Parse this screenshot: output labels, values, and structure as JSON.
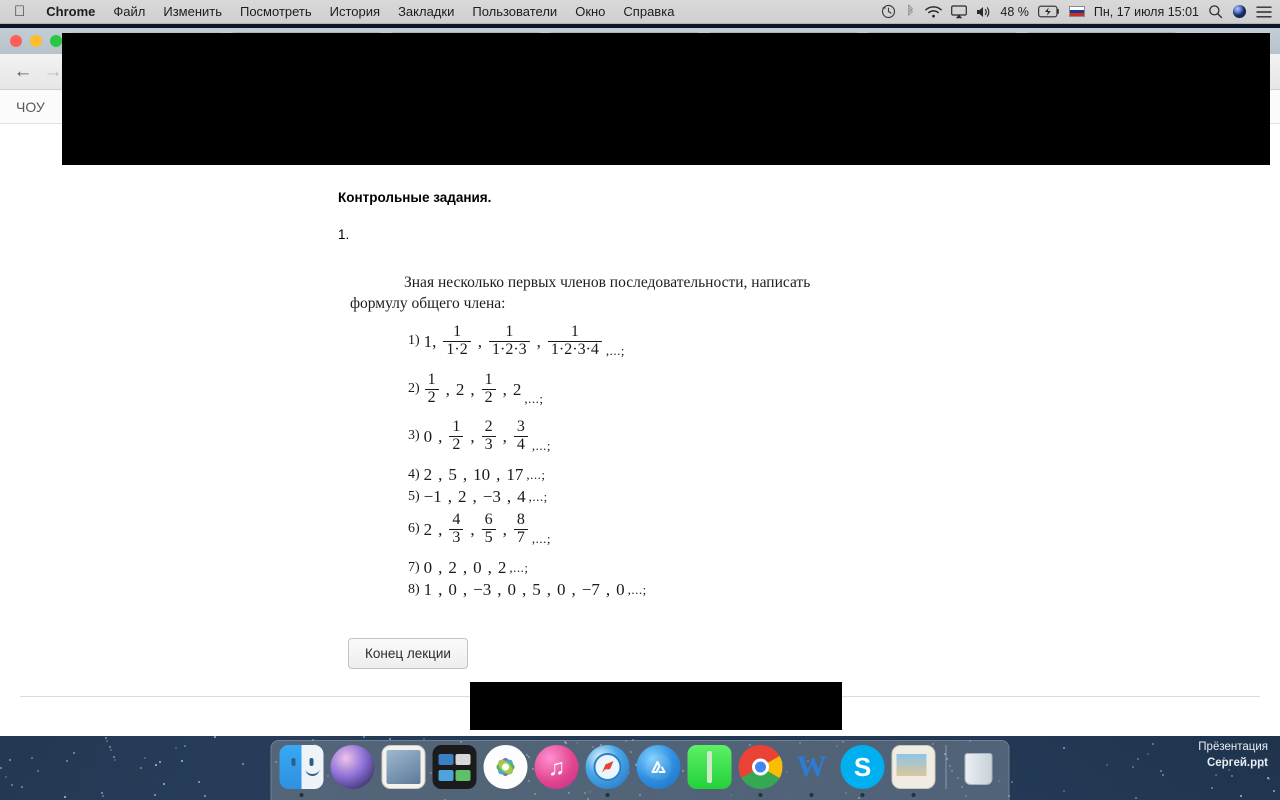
{
  "menubar": {
    "apple_icon": "apple-icon",
    "items": [
      {
        "label": "Chrome",
        "bold": true
      },
      {
        "label": "Файл",
        "bold": false
      },
      {
        "label": "Изменить",
        "bold": false
      },
      {
        "label": "Посмотреть",
        "bold": false
      },
      {
        "label": "История",
        "bold": false
      },
      {
        "label": "Закладки",
        "bold": false
      },
      {
        "label": "Пользователи",
        "bold": false
      },
      {
        "label": "Окно",
        "bold": false
      },
      {
        "label": "Справка",
        "bold": false
      }
    ],
    "status": {
      "time_machine_icon": "time-machine-icon",
      "bluetooth_icon": "bluetooth-icon",
      "wifi_icon": "wifi-icon",
      "airplay_icon": "airplay-icon",
      "volume_icon": "volume-icon",
      "battery_percent": "48 %",
      "battery_icon": "battery-charging-icon",
      "input_flag": "russian-flag-icon",
      "datetime": "Пн, 17 июля  15:01",
      "search_icon": "search-icon",
      "siri_icon": "siri-icon",
      "control_center_icon": "control-center-icon"
    }
  },
  "browser": {
    "traffic_lights": [
      "#ff5f57",
      "#ffbd2e",
      "#28c840"
    ],
    "tabs": [
      {
        "active": true
      },
      {
        "active": false
      },
      {
        "active": false
      },
      {
        "active": false
      },
      {
        "active": false
      },
      {
        "active": false
      },
      {
        "active": false
      }
    ],
    "back_icon": "back-arrow-icon",
    "forward_icon": "forward-arrow-icon",
    "bookmark_label": "ЧОУ"
  },
  "document": {
    "title": "Контрольные задания.",
    "number": "1.",
    "intro_line1": "Зная  несколько  первых  членов  последовательности,  написать",
    "intro_line2": "формулу общего члена:",
    "items": [
      {
        "label": "1)",
        "parts": [
          {
            "type": "text",
            "value": "1,"
          },
          {
            "type": "frac",
            "num": "1",
            "den": "1·2"
          },
          {
            "type": "text",
            "value": ","
          },
          {
            "type": "frac",
            "num": "1",
            "den": "1·2·3"
          },
          {
            "type": "text",
            "value": ","
          },
          {
            "type": "frac",
            "num": "1",
            "den": "1·2·3·4"
          }
        ],
        "tail": ",...;"
      },
      {
        "label": "2)",
        "parts": [
          {
            "type": "frac",
            "num": "1",
            "den": "2"
          },
          {
            "type": "text",
            "value": ","
          },
          {
            "type": "text",
            "value": "2"
          },
          {
            "type": "text",
            "value": ","
          },
          {
            "type": "frac",
            "num": "1",
            "den": "2"
          },
          {
            "type": "text",
            "value": ","
          },
          {
            "type": "text",
            "value": "2"
          }
        ],
        "tail": ",...;"
      },
      {
        "label": "3)",
        "parts": [
          {
            "type": "text",
            "value": "0"
          },
          {
            "type": "text",
            "value": ","
          },
          {
            "type": "frac",
            "num": "1",
            "den": "2"
          },
          {
            "type": "text",
            "value": ","
          },
          {
            "type": "frac",
            "num": "2",
            "den": "3"
          },
          {
            "type": "text",
            "value": ","
          },
          {
            "type": "frac",
            "num": "3",
            "den": "4"
          }
        ],
        "tail": ",...;"
      },
      {
        "label": "4)",
        "parts": [
          {
            "type": "text",
            "value": "2"
          },
          {
            "type": "text",
            "value": ","
          },
          {
            "type": "text",
            "value": "5"
          },
          {
            "type": "text",
            "value": ","
          },
          {
            "type": "text",
            "value": "10"
          },
          {
            "type": "text",
            "value": ","
          },
          {
            "type": "text",
            "value": "17"
          }
        ],
        "tail": ",...;"
      },
      {
        "label": "5)",
        "parts": [
          {
            "type": "text",
            "value": "−1"
          },
          {
            "type": "text",
            "value": ","
          },
          {
            "type": "text",
            "value": "2"
          },
          {
            "type": "text",
            "value": ","
          },
          {
            "type": "text",
            "value": "−3"
          },
          {
            "type": "text",
            "value": ","
          },
          {
            "type": "text",
            "value": "4"
          }
        ],
        "tail": ",...;"
      },
      {
        "label": "6)",
        "parts": [
          {
            "type": "text",
            "value": "2"
          },
          {
            "type": "text",
            "value": ","
          },
          {
            "type": "frac",
            "num": "4",
            "den": "3"
          },
          {
            "type": "text",
            "value": ","
          },
          {
            "type": "frac",
            "num": "6",
            "den": "5"
          },
          {
            "type": "text",
            "value": ","
          },
          {
            "type": "frac",
            "num": "8",
            "den": "7"
          }
        ],
        "tail": ",...;"
      },
      {
        "label": "7)",
        "parts": [
          {
            "type": "text",
            "value": "0"
          },
          {
            "type": "text",
            "value": ","
          },
          {
            "type": "text",
            "value": "2"
          },
          {
            "type": "text",
            "value": ","
          },
          {
            "type": "text",
            "value": "0"
          },
          {
            "type": "text",
            "value": ","
          },
          {
            "type": "text",
            "value": "2"
          }
        ],
        "tail": ",...;"
      },
      {
        "label": "8)",
        "parts": [
          {
            "type": "text",
            "value": "1"
          },
          {
            "type": "text",
            "value": ","
          },
          {
            "type": "text",
            "value": "0"
          },
          {
            "type": "text",
            "value": ","
          },
          {
            "type": "text",
            "value": "−3"
          },
          {
            "type": "text",
            "value": ","
          },
          {
            "type": "text",
            "value": "0"
          },
          {
            "type": "text",
            "value": ","
          },
          {
            "type": "text",
            "value": "5"
          },
          {
            "type": "text",
            "value": ","
          },
          {
            "type": "text",
            "value": "0"
          },
          {
            "type": "text",
            "value": ","
          },
          {
            "type": "text",
            "value": "−7"
          },
          {
            "type": "text",
            "value": ","
          },
          {
            "type": "text",
            "value": "0"
          }
        ],
        "tail": ",...;"
      }
    ],
    "end_button": "Конец лекции"
  },
  "dock": {
    "items": [
      {
        "name": "finder",
        "icon": "finder-icon",
        "running": true
      },
      {
        "name": "siri",
        "icon": "siri-icon",
        "running": false
      },
      {
        "name": "mail",
        "icon": "mail-icon",
        "running": false
      },
      {
        "name": "mission-control",
        "icon": "mission-control-icon",
        "running": false
      },
      {
        "name": "photos",
        "icon": "photos-icon",
        "running": false
      },
      {
        "name": "itunes",
        "icon": "itunes-icon",
        "running": false
      },
      {
        "name": "safari",
        "icon": "safari-icon",
        "running": true
      },
      {
        "name": "app-store",
        "icon": "app-store-icon",
        "running": false
      },
      {
        "name": "archiver",
        "icon": "archive-utility-icon",
        "running": false
      },
      {
        "name": "chrome",
        "icon": "chrome-icon",
        "running": true
      },
      {
        "name": "word",
        "icon": "word-icon",
        "running": true
      },
      {
        "name": "skype",
        "icon": "skype-icon",
        "running": true
      },
      {
        "name": "preview",
        "icon": "preview-icon",
        "running": true
      },
      {
        "name": "trash",
        "icon": "trash-icon",
        "running": false
      }
    ]
  },
  "watermark": {
    "line1": "Прёзентация",
    "line2": "Сергей.ppt"
  }
}
